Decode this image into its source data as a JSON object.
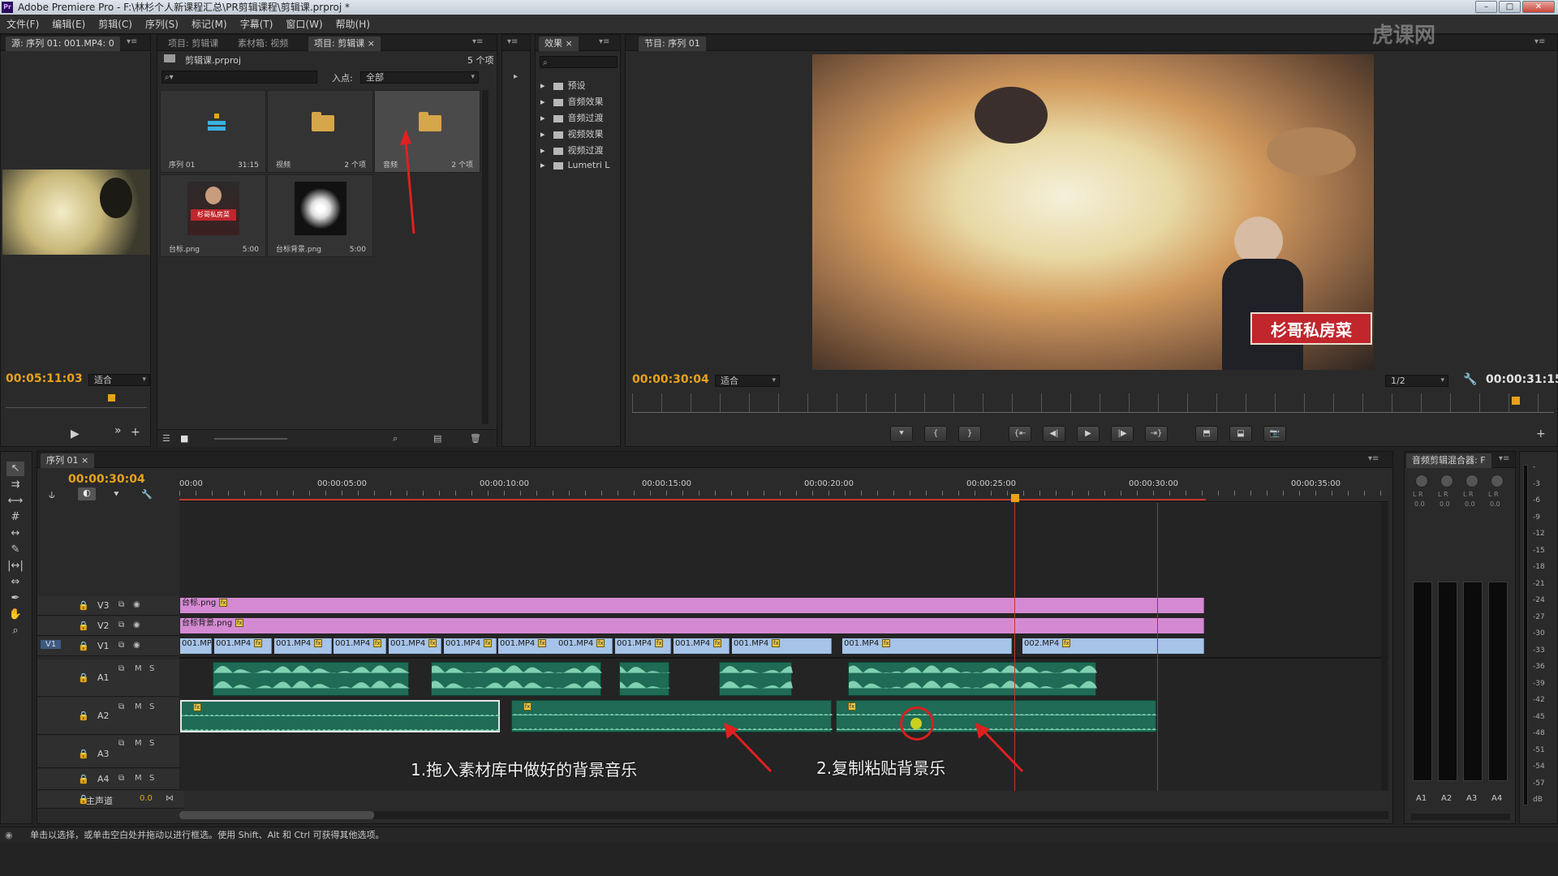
{
  "window": {
    "title": "Adobe Premiere Pro - F:\\林杉个人新课程汇总\\PR剪辑课程\\剪辑课.prproj *",
    "app_icon": "Pr",
    "watermark": "虎课网"
  },
  "menu": [
    "文件(F)",
    "编辑(E)",
    "剪辑(C)",
    "序列(S)",
    "标记(M)",
    "字幕(T)",
    "窗口(W)",
    "帮助(H)"
  ],
  "source": {
    "tab": "源: 序列 01: 001.MP4: 0",
    "timecode": "00:05:11:03",
    "fit": "适合"
  },
  "project": {
    "tabs": [
      "项目: 剪辑课",
      "素材箱: 视频",
      "项目: 剪辑课 ×"
    ],
    "file": "剪辑课.prproj",
    "count": "5 个项",
    "in_label": "入点:",
    "in_value": "全部",
    "items": [
      {
        "name": "序列 01",
        "info": "31:15"
      },
      {
        "name": "视频",
        "info": "2 个项"
      },
      {
        "name": "音频",
        "info": "2 个项"
      },
      {
        "name": "台标.png",
        "info": "5:00"
      },
      {
        "name": "台标背景.png",
        "info": "5:00"
      }
    ],
    "thumb_text": "杉哥私房菜"
  },
  "effects": {
    "tab": "效果 ×",
    "items": [
      "预设",
      "音频效果",
      "音频过渡",
      "视频效果",
      "视频过渡",
      "Lumetri L"
    ]
  },
  "program": {
    "tab": "节目: 序列 01",
    "timecode": "00:00:30:04",
    "fit": "适合",
    "quality": "1/2",
    "duration": "00:00:31:15",
    "overlay_text": "杉哥私房菜"
  },
  "timeline": {
    "tab": "序列 01 ×",
    "timecode": "00:00:30:04",
    "ruler": [
      "00:00",
      "00:00:05:00",
      "00:00:10:00",
      "00:00:15:00",
      "00:00:20:00",
      "00:00:25:00",
      "00:00:30:00",
      "00:00:35:00"
    ],
    "tracks": {
      "v3": "V3",
      "v2": "V2",
      "v1": "V1",
      "v1_src": "V1",
      "a1": "A1",
      "a2": "A2",
      "a3": "A3",
      "a4": "A4",
      "master": "主声道",
      "master_val": "0.0",
      "m": "M",
      "s": "S"
    },
    "v3_clip": "台标.png",
    "v2_clip": "台标背景.png",
    "v1_clips": [
      "001.MP",
      "001.MP4",
      "001.MP4",
      "001.MP4",
      "001.MP4",
      "001.MP4",
      "001.MP4",
      "001.MP4",
      "001.MP4",
      "001.MP4",
      "001.MP4",
      "001.MP4",
      "002.MP4"
    ]
  },
  "mixer": {
    "tab": "音频剪辑混合器: F",
    "channels": [
      "A1",
      "A2",
      "A3",
      "A4"
    ],
    "lr": "L R",
    "vals": [
      "0.0",
      "0.0",
      "0.0",
      "0.0"
    ],
    "scale": [
      "-",
      "-3",
      "-6",
      "-9",
      "-12",
      "-15",
      "-18",
      "-21",
      "-24",
      "-27",
      "-30",
      "-33",
      "-36",
      "-39",
      "-42",
      "-45",
      "-48",
      "-51",
      "-54",
      "-57",
      "dB"
    ]
  },
  "annotations": {
    "step1": "1.拖入素材库中做好的背景音乐",
    "step2": "2.复制粘贴背景乐"
  },
  "status": "单击以选择，或单击空白处并拖动以进行框选。使用 Shift、Alt 和 Ctrl 可获得其他选项。",
  "colors": {
    "accent": "#e8a21a",
    "playhead": "#c0392b",
    "video_clip": "#a6c3e8",
    "graphic_clip": "#d48ad2",
    "audio_clip": "#1f6b55"
  }
}
